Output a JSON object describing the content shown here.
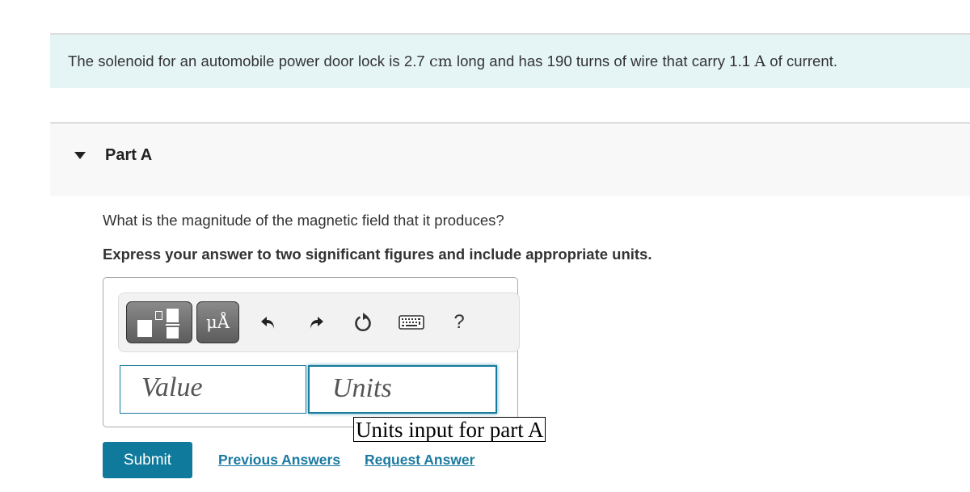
{
  "intro": {
    "segments": [
      {
        "text": "The solenoid for an automobile power door lock is 2.7 ",
        "math": false
      },
      {
        "text": "cm",
        "math": true
      },
      {
        "text": " long and has 190 turns of wire that carry 1.1 ",
        "math": false
      },
      {
        "text": "A",
        "math": true
      },
      {
        "text": " of current.",
        "math": false
      }
    ]
  },
  "part": {
    "title": "Part A",
    "expanded": true,
    "question": "What is the magnitude of the magnetic field that it produces?",
    "instruction": "Express your answer to two significant figures and include appropriate units."
  },
  "toolbar": {
    "template_button_icon": "fraction-template-icon",
    "units_button_label": "μÅ",
    "icons": [
      "undo-icon",
      "redo-icon",
      "reset-icon",
      "keyboard-icon",
      "help-icon"
    ],
    "help_label": "?"
  },
  "answer": {
    "value_placeholder": "Value",
    "units_placeholder": "Units",
    "value": "",
    "units": "",
    "units_tooltip": "Units input for part A"
  },
  "actions": {
    "submit_label": "Submit",
    "previous_answers_label": "Previous Answers",
    "request_answer_label": "Request Answer"
  },
  "colors": {
    "accent": "#0f7a9c",
    "intro_bg": "#e5f5f6",
    "part_header_bg": "#f8f8f8"
  }
}
